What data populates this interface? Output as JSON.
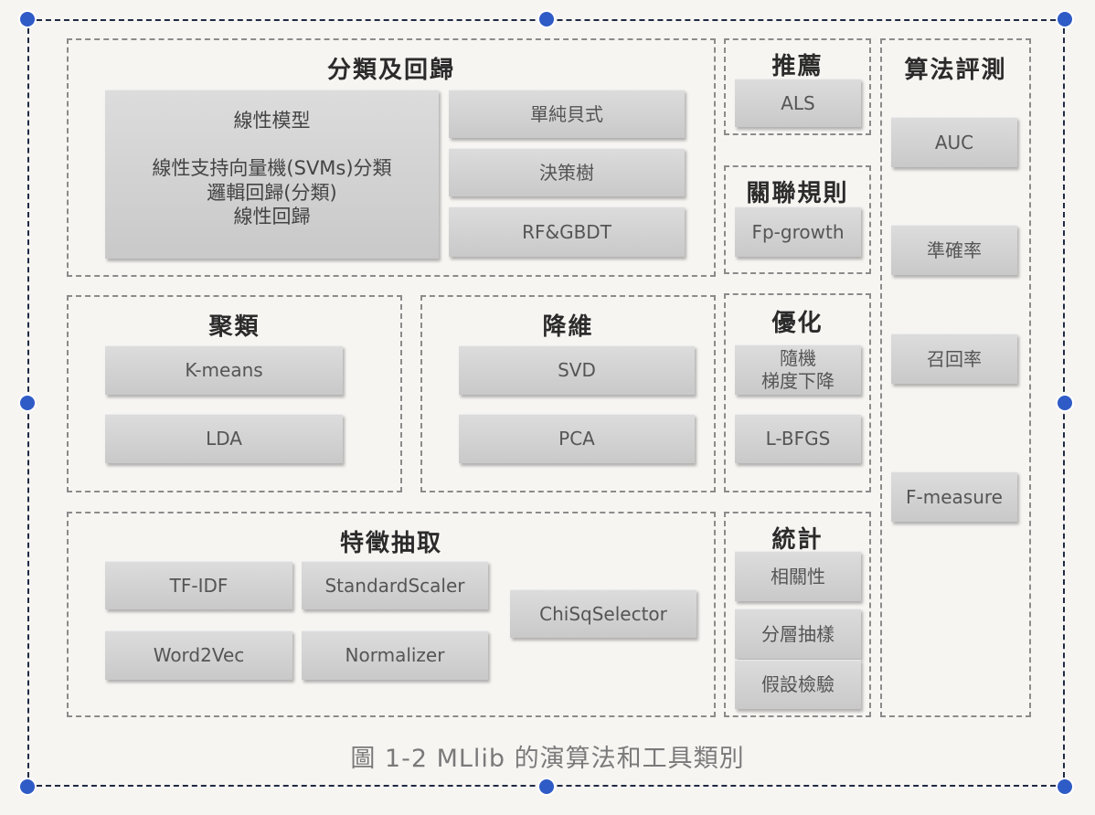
{
  "groups": {
    "classification": {
      "title": "分類及回歸",
      "model_box": [
        "線性模型",
        "線性支持向量機(SVMs)分類",
        "邏輯回歸(分類)",
        "線性回歸"
      ],
      "items": [
        "單純貝式",
        "決策樹",
        "RF&GBDT"
      ]
    },
    "recommendation": {
      "title": "推薦",
      "items": [
        "ALS"
      ]
    },
    "association": {
      "title": "關聯規則",
      "items": [
        "Fp-growth"
      ]
    },
    "evaluation": {
      "title": "算法評測",
      "items": [
        "AUC",
        "準確率",
        "召回率",
        "F-measure"
      ]
    },
    "clustering": {
      "title": "聚類",
      "items": [
        "K-means",
        "LDA"
      ]
    },
    "dimreduction": {
      "title": "降維",
      "items": [
        "SVD",
        "PCA"
      ]
    },
    "optimization": {
      "title": "優化",
      "items": [
        "隨機\n梯度下降",
        "L-BFGS"
      ]
    },
    "feature": {
      "title": "特徵抽取",
      "items": [
        "TF-IDF",
        "StandardScaler",
        "ChiSqSelector",
        "Word2Vec",
        "Normalizer"
      ]
    },
    "statistics": {
      "title": "統計",
      "items": [
        "相關性",
        "分層抽樣",
        "假設檢驗"
      ]
    }
  },
  "caption": "圖 1-2  MLlib 的演算法和工具類別"
}
